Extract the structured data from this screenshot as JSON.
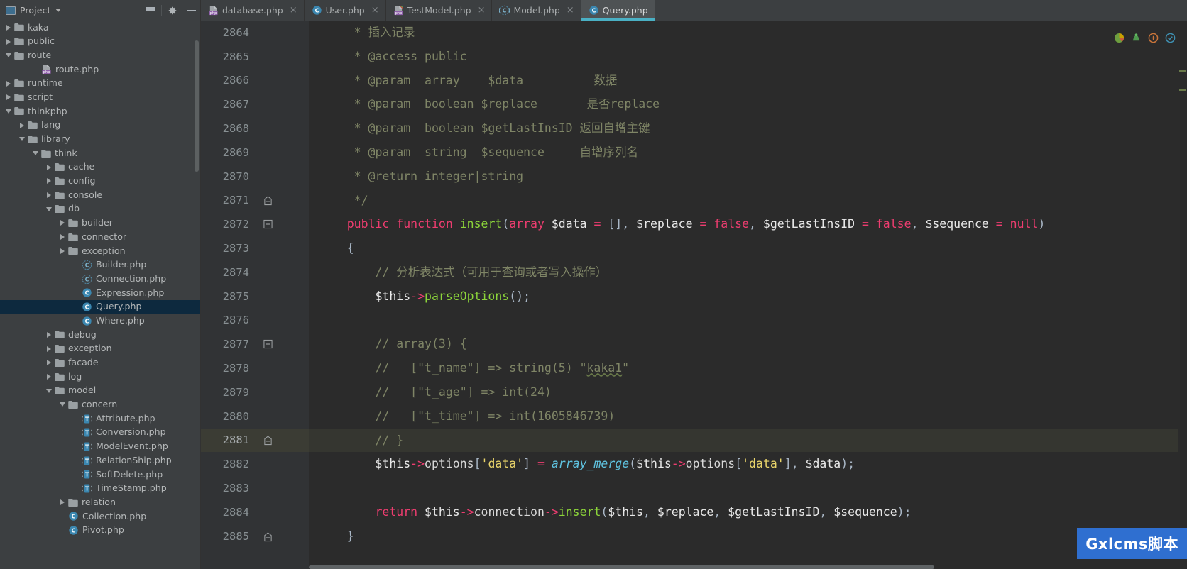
{
  "window": {
    "project_panel_title": "Project",
    "toolbar_icons": [
      "collapse-all-icon",
      "settings-gear-icon",
      "hide-panel-icon"
    ]
  },
  "tabs": [
    {
      "label": "database.php",
      "icon": "php-file-icon",
      "active": false,
      "close": "×"
    },
    {
      "label": "User.php",
      "icon": "php-class-icon",
      "active": false,
      "close": "×"
    },
    {
      "label": "TestModel.php",
      "icon": "php-file-green-icon",
      "active": false,
      "close": "×"
    },
    {
      "label": "Model.php",
      "icon": "php-abstract-class-icon",
      "active": false,
      "close": "×"
    },
    {
      "label": "Query.php",
      "icon": "php-class-icon",
      "active": true,
      "close": ""
    }
  ],
  "tree": [
    {
      "label": "kaka",
      "depth": 1,
      "type": "folder",
      "state": "collapsed"
    },
    {
      "label": "public",
      "depth": 1,
      "type": "folder",
      "state": "collapsed"
    },
    {
      "label": "route",
      "depth": 1,
      "type": "folder",
      "state": "expanded"
    },
    {
      "label": "route.php",
      "depth": 3,
      "type": "php",
      "state": "leaf"
    },
    {
      "label": "runtime",
      "depth": 1,
      "type": "folder",
      "state": "collapsed"
    },
    {
      "label": "script",
      "depth": 1,
      "type": "folder",
      "state": "collapsed"
    },
    {
      "label": "thinkphp",
      "depth": 1,
      "type": "folder",
      "state": "expanded"
    },
    {
      "label": "lang",
      "depth": 2,
      "type": "folder",
      "state": "collapsed"
    },
    {
      "label": "library",
      "depth": 2,
      "type": "folder",
      "state": "expanded"
    },
    {
      "label": "think",
      "depth": 3,
      "type": "folder",
      "state": "expanded"
    },
    {
      "label": "cache",
      "depth": 4,
      "type": "folder",
      "state": "collapsed"
    },
    {
      "label": "config",
      "depth": 4,
      "type": "folder",
      "state": "collapsed"
    },
    {
      "label": "console",
      "depth": 4,
      "type": "folder",
      "state": "collapsed"
    },
    {
      "label": "db",
      "depth": 4,
      "type": "folder",
      "state": "expanded"
    },
    {
      "label": "builder",
      "depth": 5,
      "type": "folder",
      "state": "collapsed"
    },
    {
      "label": "connector",
      "depth": 5,
      "type": "folder",
      "state": "collapsed"
    },
    {
      "label": "exception",
      "depth": 5,
      "type": "folder",
      "state": "collapsed"
    },
    {
      "label": "Builder.php",
      "depth": 6,
      "type": "abstract-class",
      "state": "leaf"
    },
    {
      "label": "Connection.php",
      "depth": 6,
      "type": "abstract-class",
      "state": "leaf"
    },
    {
      "label": "Expression.php",
      "depth": 6,
      "type": "class",
      "state": "leaf"
    },
    {
      "label": "Query.php",
      "depth": 6,
      "type": "class",
      "state": "leaf",
      "selected": true
    },
    {
      "label": "Where.php",
      "depth": 6,
      "type": "class",
      "state": "leaf"
    },
    {
      "label": "debug",
      "depth": 4,
      "type": "folder",
      "state": "collapsed"
    },
    {
      "label": "exception",
      "depth": 4,
      "type": "folder",
      "state": "collapsed"
    },
    {
      "label": "facade",
      "depth": 4,
      "type": "folder",
      "state": "collapsed"
    },
    {
      "label": "log",
      "depth": 4,
      "type": "folder",
      "state": "collapsed"
    },
    {
      "label": "model",
      "depth": 4,
      "type": "folder",
      "state": "expanded"
    },
    {
      "label": "concern",
      "depth": 5,
      "type": "folder",
      "state": "expanded"
    },
    {
      "label": "Attribute.php",
      "depth": 6,
      "type": "trait",
      "state": "leaf"
    },
    {
      "label": "Conversion.php",
      "depth": 6,
      "type": "trait",
      "state": "leaf"
    },
    {
      "label": "ModelEvent.php",
      "depth": 6,
      "type": "trait",
      "state": "leaf"
    },
    {
      "label": "RelationShip.php",
      "depth": 6,
      "type": "trait",
      "state": "leaf"
    },
    {
      "label": "SoftDelete.php",
      "depth": 6,
      "type": "trait",
      "state": "leaf"
    },
    {
      "label": "TimeStamp.php",
      "depth": 6,
      "type": "trait",
      "state": "leaf"
    },
    {
      "label": "relation",
      "depth": 5,
      "type": "folder",
      "state": "collapsed"
    },
    {
      "label": "Collection.php",
      "depth": 5,
      "type": "class",
      "state": "leaf"
    },
    {
      "label": "Pivot.php",
      "depth": 5,
      "type": "class",
      "state": "leaf"
    }
  ],
  "editor": {
    "first_line": 2864,
    "current_line": 2881,
    "lines": [
      {
        "n": 2864,
        "fold": "",
        "html": "     <span class='t-com'>* 插入记录</span>"
      },
      {
        "n": 2865,
        "fold": "",
        "html": "     <span class='t-com'>* @access public</span>"
      },
      {
        "n": 2866,
        "fold": "",
        "html": "     <span class='t-com'>* @param  array    $data          数据</span>"
      },
      {
        "n": 2867,
        "fold": "",
        "html": "     <span class='t-com'>* @param  boolean $replace       是否replace</span>"
      },
      {
        "n": 2868,
        "fold": "",
        "html": "     <span class='t-com'>* @param  boolean $getLastInsID 返回自增主键</span>"
      },
      {
        "n": 2869,
        "fold": "",
        "html": "     <span class='t-com'>* @param  string  $sequence     自增序列名</span>"
      },
      {
        "n": 2870,
        "fold": "",
        "html": "     <span class='t-com'>* @return integer|string</span>"
      },
      {
        "n": 2871,
        "fold": "end",
        "html": "     <span class='t-com'>*/</span>"
      },
      {
        "n": 2872,
        "fold": "minus",
        "html": "    <span class='t-kw'>public function</span> <span class='t-fn'>insert</span>(<span class='t-kw'>array</span> <span class='t-var'>$data</span> <span class='t-op'>=</span> [], <span class='t-var'>$replace</span> <span class='t-op'>=</span> <span class='t-kw'>false</span>, <span class='t-var'>$getLastInsID</span> <span class='t-op'>=</span> <span class='t-kw'>false</span>, <span class='t-var'>$sequence</span> <span class='t-op'>=</span> <span class='t-kw'>null</span>)"
      },
      {
        "n": 2873,
        "fold": "",
        "html": "    {"
      },
      {
        "n": 2874,
        "fold": "",
        "html": "        <span class='t-com'>// 分析表达式（可用于查询或者写入操作）</span>"
      },
      {
        "n": 2875,
        "fold": "",
        "html": "        <span class='t-var'>$this</span><span class='t-arrow'>-&gt;</span><span class='t-fn'>parseOptions</span>();"
      },
      {
        "n": 2876,
        "fold": "",
        "html": ""
      },
      {
        "n": 2877,
        "fold": "minus",
        "html": "        <span class='t-com'>// array(3) {</span>"
      },
      {
        "n": 2878,
        "fold": "",
        "html": "        <span class='t-com'>//   [\"t_name\"] =&gt; string(5) \"<span class='typo'>kaka1</span>\"</span>"
      },
      {
        "n": 2879,
        "fold": "",
        "html": "        <span class='t-com'>//   [\"t_age\"] =&gt; int(24)</span>"
      },
      {
        "n": 2880,
        "fold": "",
        "html": "        <span class='t-com'>//   [\"t_time\"] =&gt; int(1605846739)</span>"
      },
      {
        "n": 2881,
        "fold": "end",
        "html": "        <span class='t-com'>// }</span>"
      },
      {
        "n": 2882,
        "fold": "",
        "html": "        <span class='t-var'>$this</span><span class='t-arrow'>-&gt;</span><span class='t-plain'>options</span>[<span class='t-str'>'data'</span>] <span class='t-op'>=</span> <span class='t-builtin'>array_merge</span>(<span class='t-var'>$this</span><span class='t-arrow'>-&gt;</span><span class='t-plain'>options</span>[<span class='t-str'>'data'</span>], <span class='t-var'>$data</span>);"
      },
      {
        "n": 2883,
        "fold": "",
        "html": ""
      },
      {
        "n": 2884,
        "fold": "",
        "html": "        <span class='t-kw'>return</span> <span class='t-var'>$this</span><span class='t-arrow'>-&gt;</span><span class='t-plain'>connection</span><span class='t-arrow'>-&gt;</span><span class='t-fn'>insert</span>(<span class='t-var'>$this</span>, <span class='t-var'>$replace</span>, <span class='t-var'>$getLastInsID</span>, <span class='t-var'>$sequence</span>);"
      },
      {
        "n": 2885,
        "fold": "end",
        "html": "    }"
      }
    ],
    "inspection_icons": [
      "inspection-pie-icon",
      "hector-green-icon",
      "reader-mode-icon",
      "inspection-ok-icon"
    ]
  },
  "watermark": {
    "text": "Gxlcms脚本"
  },
  "colors": {
    "accent": "#4ab0c4",
    "selection": "#0d293e",
    "editor_bg": "#2b2b2b",
    "gutter_bg": "#313335",
    "panel_bg": "#3c3f41",
    "current_line": "#353630",
    "keyword": "#ee3d70",
    "function": "#8cd43a",
    "comment": "#7f8566",
    "string": "#e9d46a",
    "builtin": "#5fc3e0",
    "watermark_bg": "#2f6fd0"
  }
}
